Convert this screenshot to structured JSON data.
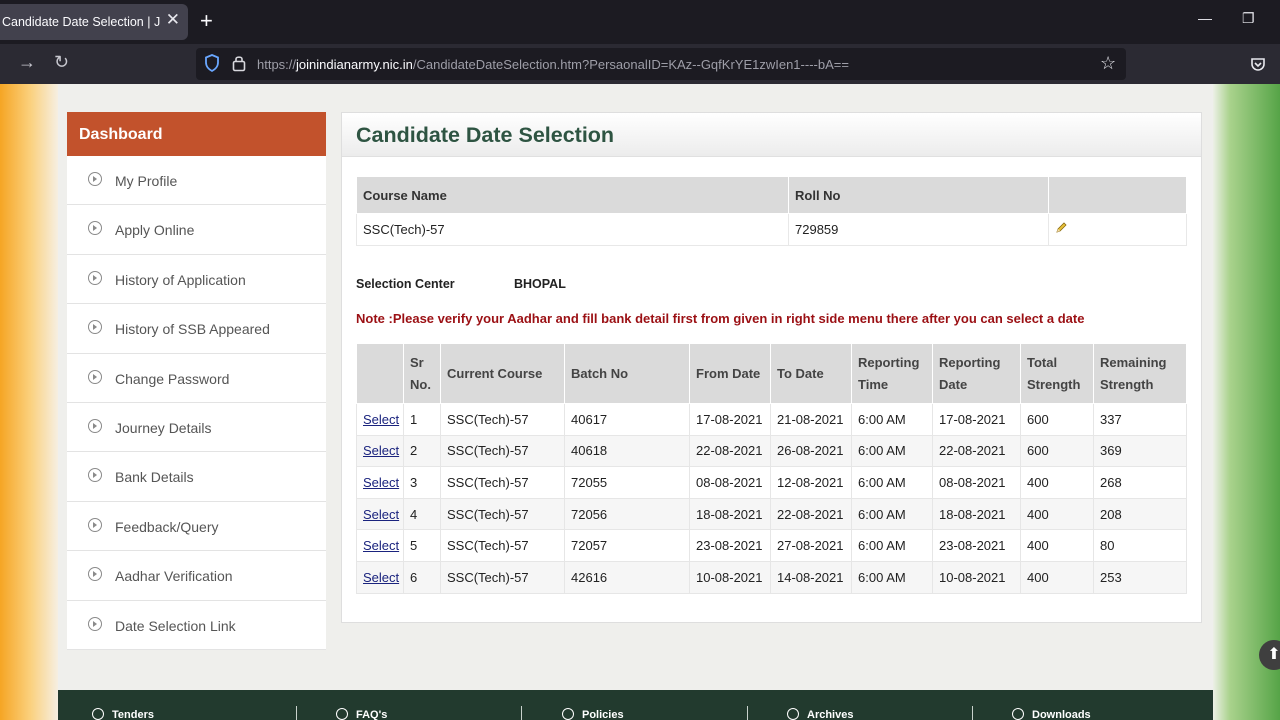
{
  "browser": {
    "tab_title": "Candidate Date Selection | Join Indian Army",
    "url_prefix": "https://",
    "url_host": "joinindianarmy.nic.in",
    "url_path": "/CandidateDateSelection.htm?PersaonalID=KAz--GqfKrYE1zwIen1----bA=="
  },
  "sidebar": {
    "header": "Dashboard",
    "items": [
      {
        "label": "My Profile"
      },
      {
        "label": "Apply Online"
      },
      {
        "label": "History of Application"
      },
      {
        "label": "History of SSB Appeared"
      },
      {
        "label": "Change Password"
      },
      {
        "label": "Journey Details"
      },
      {
        "label": "Bank Details"
      },
      {
        "label": "Feedback/Query"
      },
      {
        "label": "Aadhar Verification"
      },
      {
        "label": "Date Selection Link"
      }
    ]
  },
  "main": {
    "title": "Candidate Date Selection",
    "course_table": {
      "headers": {
        "course": "Course Name",
        "roll": "Roll No"
      },
      "row": {
        "course": "SSC(Tech)-57",
        "roll": "729859"
      }
    },
    "selection_center": {
      "label": "Selection Center",
      "value": "BHOPAL"
    },
    "note": "Note :Please verify your Aadhar and fill bank detail first from given in right side menu there after you can select a date",
    "batch_table": {
      "headers": {
        "sr": [
          "Sr",
          "No."
        ],
        "course": "Current Course",
        "batch": "Batch No",
        "from": "From Date",
        "to": "To Date",
        "time": [
          "Reporting",
          "Time"
        ],
        "rdate": [
          "Reporting",
          "Date"
        ],
        "total": [
          "Total",
          "Strength"
        ],
        "remaining": [
          "Remaining",
          "Strength"
        ]
      },
      "rows": [
        {
          "select": "Select",
          "sr": "1",
          "course": "SSC(Tech)-57",
          "batch": "40617",
          "from": "17-08-2021",
          "to": "21-08-2021",
          "time": "6:00 AM",
          "rdate": "17-08-2021",
          "total": "600",
          "remaining": "337"
        },
        {
          "select": "Select",
          "sr": "2",
          "course": "SSC(Tech)-57",
          "batch": "40618",
          "from": "22-08-2021",
          "to": "26-08-2021",
          "time": "6:00 AM",
          "rdate": "22-08-2021",
          "total": "600",
          "remaining": "369"
        },
        {
          "select": "Select",
          "sr": "3",
          "course": "SSC(Tech)-57",
          "batch": "72055",
          "from": "08-08-2021",
          "to": "12-08-2021",
          "time": "6:00 AM",
          "rdate": "08-08-2021",
          "total": "400",
          "remaining": "268"
        },
        {
          "select": "Select",
          "sr": "4",
          "course": "SSC(Tech)-57",
          "batch": "72056",
          "from": "18-08-2021",
          "to": "22-08-2021",
          "time": "6:00 AM",
          "rdate": "18-08-2021",
          "total": "400",
          "remaining": "208"
        },
        {
          "select": "Select",
          "sr": "5",
          "course": "SSC(Tech)-57",
          "batch": "72057",
          "from": "23-08-2021",
          "to": "27-08-2021",
          "time": "6:00 AM",
          "rdate": "23-08-2021",
          "total": "400",
          "remaining": "80"
        },
        {
          "select": "Select",
          "sr": "6",
          "course": "SSC(Tech)-57",
          "batch": "42616",
          "from": "10-08-2021",
          "to": "14-08-2021",
          "time": "6:00 AM",
          "rdate": "10-08-2021",
          "total": "400",
          "remaining": "253"
        }
      ]
    }
  },
  "footer": {
    "links": [
      {
        "label": "Tenders"
      },
      {
        "label": "FAQ's"
      },
      {
        "label": "Policies"
      },
      {
        "label": "Archives"
      },
      {
        "label": "Downloads"
      }
    ]
  },
  "colors": {
    "dashboard_header": "#c2522c",
    "title_green": "#2e5442",
    "note_red": "#9b1014",
    "footer_bg": "#223a2e"
  }
}
